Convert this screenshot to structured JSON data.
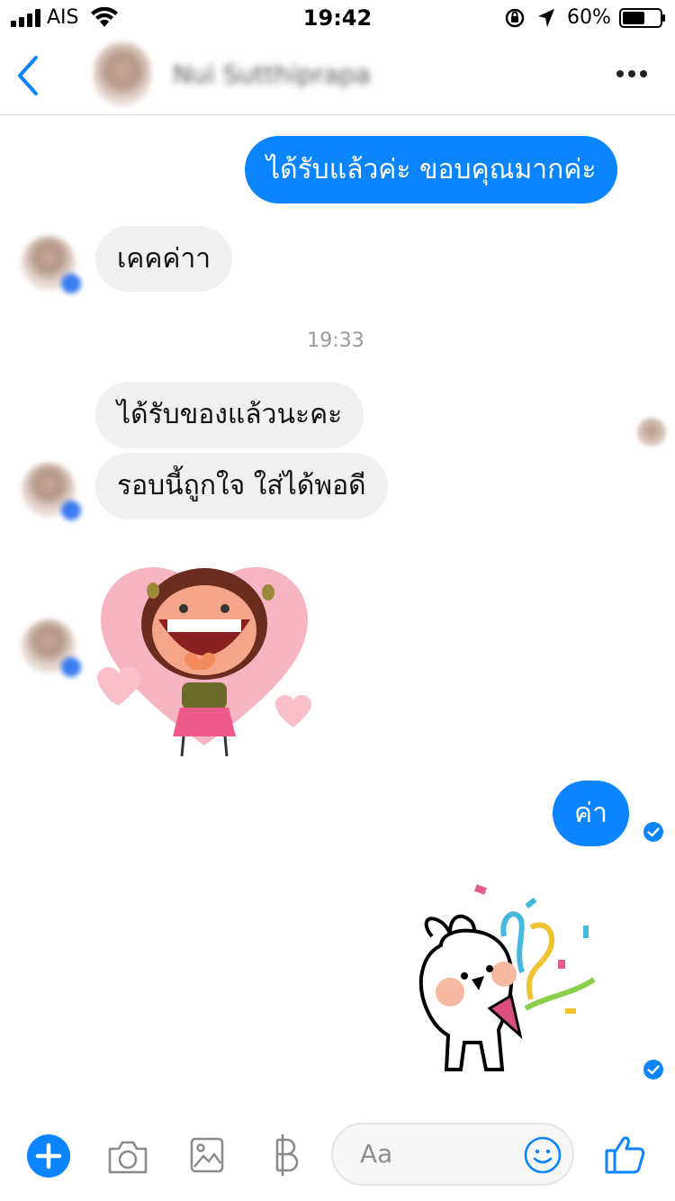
{
  "status_bar": {
    "carrier": "AIS",
    "time": "19:42",
    "battery_percent": "60%",
    "battery_level": 0.6
  },
  "header": {
    "contact_name": "Nui Sutthiprapa",
    "back_icon": "chevron-left-icon",
    "more_icon": "ellipsis-icon"
  },
  "conversation": {
    "messages": [
      {
        "direction": "out",
        "type": "text",
        "text": "ได้รับแล้วค่ะ ขอบคุณมากค่ะ"
      },
      {
        "direction": "in",
        "type": "text",
        "text": "เคคค่าา"
      },
      {
        "type": "timestamp",
        "text": "19:33"
      },
      {
        "direction": "in",
        "type": "text",
        "text": "ได้รับของแล้วนะคะ"
      },
      {
        "direction": "in",
        "type": "text",
        "text": "รอบนี้ถูกใจ ใส่ได้พอดี"
      },
      {
        "direction": "in",
        "type": "sticker",
        "sticker": "girl-heart-sticker"
      },
      {
        "direction": "out",
        "type": "text",
        "text": "ค่า",
        "status": "sent"
      },
      {
        "direction": "out",
        "type": "sticker",
        "sticker": "rabbit-party-popper-sticker",
        "status": "sent"
      }
    ]
  },
  "composer": {
    "placeholder": "Aa",
    "icons": [
      "plus-icon",
      "camera-icon",
      "image-icon",
      "baht-icon",
      "emoji-icon",
      "thumbs-up-icon"
    ]
  },
  "colors": {
    "accent": "#0a84ff",
    "incoming_bubble": "#f0f0f0",
    "timestamp": "#999999"
  }
}
